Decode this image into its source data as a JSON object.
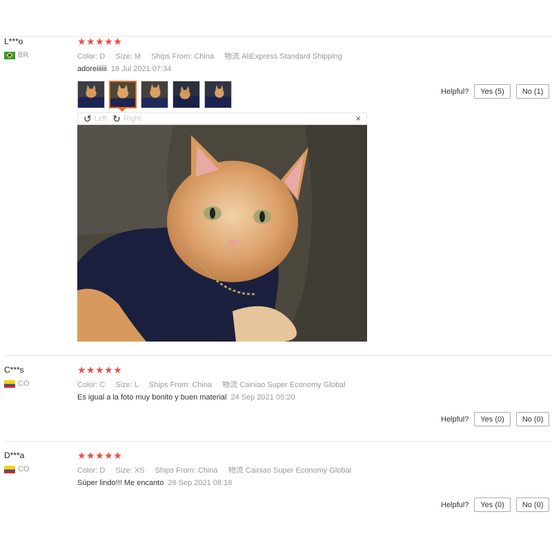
{
  "reviews": [
    {
      "user": "L***o",
      "country": "BR",
      "stars": "★★★★★",
      "color_label": "Color:",
      "color": "D",
      "size_label": "Size:",
      "size": "M",
      "ships_label": "Ships From:",
      "ships": "China",
      "logistics_label": "物流",
      "logistics": "AliExpress Standard Shipping",
      "text": "adoreiiiiii",
      "date": "18 Jul 2021 07:34",
      "helpful_label": "Helpful?",
      "yes": "Yes (5)",
      "no": "No (1)"
    },
    {
      "user": "C***s",
      "country": "CO",
      "stars": "★★★★★",
      "color_label": "Color:",
      "color": "C",
      "size_label": "Size:",
      "size": "L",
      "ships_label": "Ships From:",
      "ships": "China",
      "logistics_label": "物流",
      "logistics": "Cainiao Super Economy Global",
      "text": "Es igual a la foto muy bonito y buen material",
      "date": "24 Sep 2021 05:20",
      "helpful_label": "Helpful?",
      "yes": "Yes (0)",
      "no": "No (0)"
    },
    {
      "user": "D***a",
      "country": "CO",
      "stars": "★★★★★",
      "color_label": "Color:",
      "color": "D",
      "size_label": "Size:",
      "size": "XS",
      "ships_label": "Ships From:",
      "ships": "China",
      "logistics_label": "物流",
      "logistics": "Cainiao Super Economy Global",
      "text": "Súper lindo!!! Me encanto",
      "date": "28 Sep 2021 08:18",
      "helpful_label": "Helpful?",
      "yes": "Yes (0)",
      "no": "No (0)"
    }
  ],
  "viewer": {
    "left_label": "Left",
    "right_label": "Right",
    "close": "×",
    "rotate_left_icon": "↺",
    "rotate_right_icon": "↻"
  },
  "colors": {
    "stars": "#f04848",
    "selected_thumb": "#e56b1f"
  },
  "icons": [
    "rotate-left-icon",
    "rotate-right-icon",
    "close-icon",
    "flag-br-icon",
    "flag-co-icon",
    "star-icon"
  ]
}
